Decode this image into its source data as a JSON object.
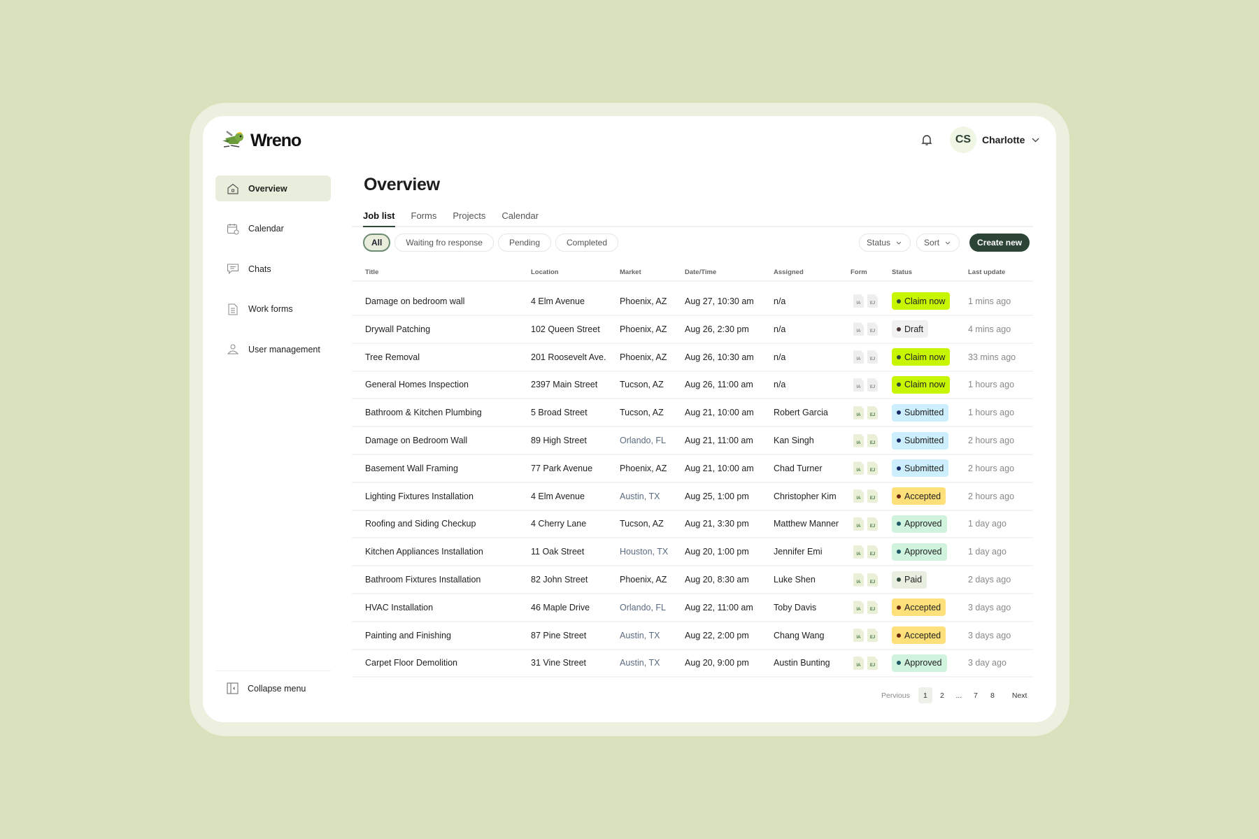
{
  "app": {
    "brand": "Wreno"
  },
  "user": {
    "initials": "CS",
    "name": "Charlotte"
  },
  "sidebar": {
    "items": [
      {
        "label": "Overview",
        "icon": "home-icon",
        "active": true
      },
      {
        "label": "Calendar",
        "icon": "calendar-icon"
      },
      {
        "label": "Chats",
        "icon": "chat-icon"
      },
      {
        "label": "Work forms",
        "icon": "document-icon"
      },
      {
        "label": "User management",
        "icon": "user-icon"
      }
    ],
    "collapse_label": "Collapse menu"
  },
  "main": {
    "title": "Overview",
    "tabs": [
      "Job list",
      "Forms",
      "Projects",
      "Calendar"
    ],
    "filters": [
      "All",
      "Waiting fro response",
      "Pending",
      "Completed"
    ],
    "status_label": "Status",
    "sort_label": "Sort",
    "create_label": "Create new"
  },
  "table": {
    "headers": [
      "Title",
      "Location",
      "Market",
      "Date/Time",
      "Assigned",
      "Form",
      "Status",
      "Last update"
    ],
    "form_labels": [
      "IA",
      "EJ"
    ],
    "rows": [
      {
        "title": "Damage on bedroom wall",
        "location": "4 Elm Avenue",
        "market": "Phoenix, AZ",
        "muted": false,
        "date": "Aug 27, 10:30 am",
        "assigned": "n/a",
        "forms_done": false,
        "status": "Claim now",
        "kind": "claim",
        "last": "1 mins ago"
      },
      {
        "title": "Drywall Patching",
        "location": "102 Queen Street",
        "market": "Phoenix, AZ",
        "muted": false,
        "date": "Aug 26, 2:30 pm",
        "assigned": "n/a",
        "forms_done": false,
        "status": "Draft",
        "kind": "draft",
        "last": "4 mins ago"
      },
      {
        "title": "Tree Removal",
        "location": "201 Roosevelt Ave.",
        "market": "Phoenix, AZ",
        "muted": false,
        "date": "Aug 26, 10:30 am",
        "assigned": "n/a",
        "forms_done": false,
        "status": "Claim now",
        "kind": "claim",
        "last": "33 mins ago"
      },
      {
        "title": "General Homes Inspection",
        "location": "2397 Main Street",
        "market": "Tucson, AZ",
        "muted": false,
        "date": "Aug 26, 11:00 am",
        "assigned": "n/a",
        "forms_done": false,
        "status": "Claim now",
        "kind": "claim",
        "last": "1 hours ago"
      },
      {
        "title": "Bathroom & Kitchen Plumbing",
        "location": "5 Broad Street",
        "market": "Tucson, AZ",
        "muted": false,
        "date": "Aug 21, 10:00 am",
        "assigned": "Robert Garcia",
        "forms_done": true,
        "status": "Submitted",
        "kind": "submitted",
        "last": "1 hours ago"
      },
      {
        "title": "Damage on Bedroom Wall",
        "location": "89 High Street",
        "market": "Orlando, FL",
        "muted": true,
        "date": "Aug 21, 11:00 am",
        "assigned": "Kan Singh",
        "forms_done": true,
        "status": "Submitted",
        "kind": "submitted",
        "last": "2 hours ago"
      },
      {
        "title": "Basement Wall Framing",
        "location": "77 Park Avenue",
        "market": "Phoenix, AZ",
        "muted": false,
        "date": "Aug 21, 10:00 am",
        "assigned": "Chad Turner",
        "forms_done": true,
        "status": "Submitted",
        "kind": "submitted",
        "last": "2 hours ago"
      },
      {
        "title": "Lighting Fixtures Installation",
        "location": "4 Elm Avenue",
        "market": "Austin, TX",
        "muted": true,
        "date": "Aug 25, 1:00 pm",
        "assigned": "Christopher Kim",
        "forms_done": true,
        "status": "Accepted",
        "kind": "accepted",
        "last": "2 hours ago"
      },
      {
        "title": "Roofing and Siding Checkup",
        "location": "4 Cherry Lane",
        "market": "Tucson, AZ",
        "muted": false,
        "date": "Aug 21, 3:30 pm",
        "assigned": "Matthew Manner",
        "forms_done": true,
        "status": "Approved",
        "kind": "approved",
        "last": "1 day ago"
      },
      {
        "title": "Kitchen Appliances Installation",
        "location": "11 Oak Street",
        "market": "Houston, TX",
        "muted": true,
        "date": "Aug 20, 1:00 pm",
        "assigned": "Jennifer Emi",
        "forms_done": true,
        "status": "Approved",
        "kind": "approved",
        "last": "1 day ago"
      },
      {
        "title": "Bathroom Fixtures Installation",
        "location": "82 John Street",
        "market": "Phoenix, AZ",
        "muted": false,
        "date": "Aug 20, 8:30 am",
        "assigned": "Luke Shen",
        "forms_done": true,
        "status": "Paid",
        "kind": "paid",
        "last": "2 days ago"
      },
      {
        "title": "HVAC Installation",
        "location": "46 Maple Drive",
        "market": "Orlando, FL",
        "muted": true,
        "date": "Aug 22, 11:00 am",
        "assigned": "Toby Davis",
        "forms_done": true,
        "status": "Accepted",
        "kind": "accepted",
        "last": "3 days ago"
      },
      {
        "title": "Painting and Finishing",
        "location": "87 Pine Street",
        "market": "Austin, TX",
        "muted": true,
        "date": "Aug 22, 2:00 pm",
        "assigned": "Chang Wang",
        "forms_done": true,
        "status": "Accepted",
        "kind": "accepted",
        "last": "3 days ago"
      },
      {
        "title": "Carpet Floor Demolition",
        "location": "31 Vine Street",
        "market": "Austin, TX",
        "muted": true,
        "date": "Aug 20, 9:00 pm",
        "assigned": "Austin Bunting",
        "forms_done": true,
        "status": "Approved",
        "kind": "approved",
        "last": "3 day ago"
      }
    ]
  },
  "status_colors": {
    "claim": {
      "bg": "#c8f500",
      "dot": "#2f4a3a"
    },
    "draft": {
      "bg": "#f1f1f1",
      "dot": "#4a3535"
    },
    "submitted": {
      "bg": "#cdeefc",
      "dot": "#1b2a6b"
    },
    "accepted": {
      "bg": "#fde07a",
      "dot": "#6b2410"
    },
    "approved": {
      "bg": "#d0f3dd",
      "dot": "#1f5a6b"
    },
    "paid": {
      "bg": "#e9efe0",
      "dot": "#2f4a3a"
    }
  },
  "pagination": {
    "previous": "Pervious",
    "pages": [
      "1",
      "2",
      "...",
      "7",
      "8"
    ],
    "current": "1",
    "next": "Next"
  }
}
